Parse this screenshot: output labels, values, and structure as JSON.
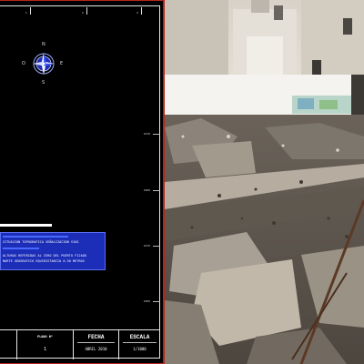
{
  "cad": {
    "compass": {
      "north": "N",
      "south": "S",
      "east": "E",
      "west": "O"
    },
    "top_marks": [
      "1",
      "2",
      "3"
    ],
    "side_marks": [
      "2670",
      "2680",
      "2670",
      "2660",
      "2670"
    ],
    "legend": {
      "line1": "SITUACION TOPOGRAFICA SEÑALIZACION VIAS",
      "line2": "ALTURAS REFERIDAS AL CERO DEL PUERTO FIJADO",
      "line3": "NORTE GEOGRAFICO  EQUIDISTANCIA 0.50 METROS"
    },
    "titleblock": {
      "col1_head": "",
      "col2_head": "PLANO Nº",
      "col2_val": "1",
      "col3_head": "FECHA",
      "col3_val": "ABRIL 2010",
      "col4_head": "ESCALA",
      "col4_val": "1/1000"
    },
    "colors": {
      "frame": "#b5251d",
      "legend_bg": "#1c2eb8",
      "background": "#000000"
    }
  },
  "photo": {
    "description_icon": "rubble-photo"
  }
}
